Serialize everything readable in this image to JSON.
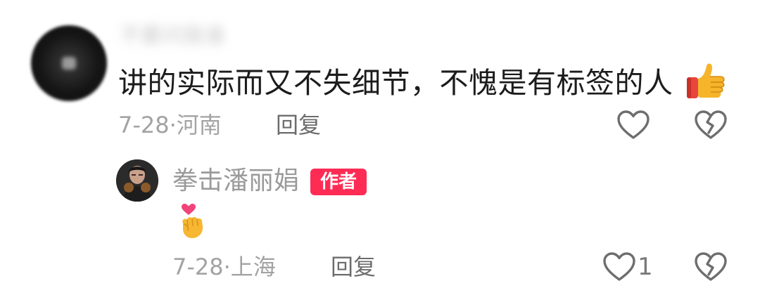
{
  "comment": {
    "username": "不要问我谁",
    "text": "讲的实际而又不失细节，不愧是有标签的人",
    "date": "7-28",
    "location": "河南",
    "meta_separator": "·",
    "reply_label": "回复",
    "trailing_emoji": "thumbs-up"
  },
  "reply": {
    "username": "拳击潘丽娟",
    "author_badge": "作者",
    "content_emoji": "finger-heart",
    "date": "7-28",
    "location": "上海",
    "meta_separator": "·",
    "reply_label": "回复",
    "like_count": "1"
  },
  "colors": {
    "badge": "#fe2c55",
    "meta_gray": "#a3a3a3",
    "text_dark": "#1c1c1c"
  }
}
